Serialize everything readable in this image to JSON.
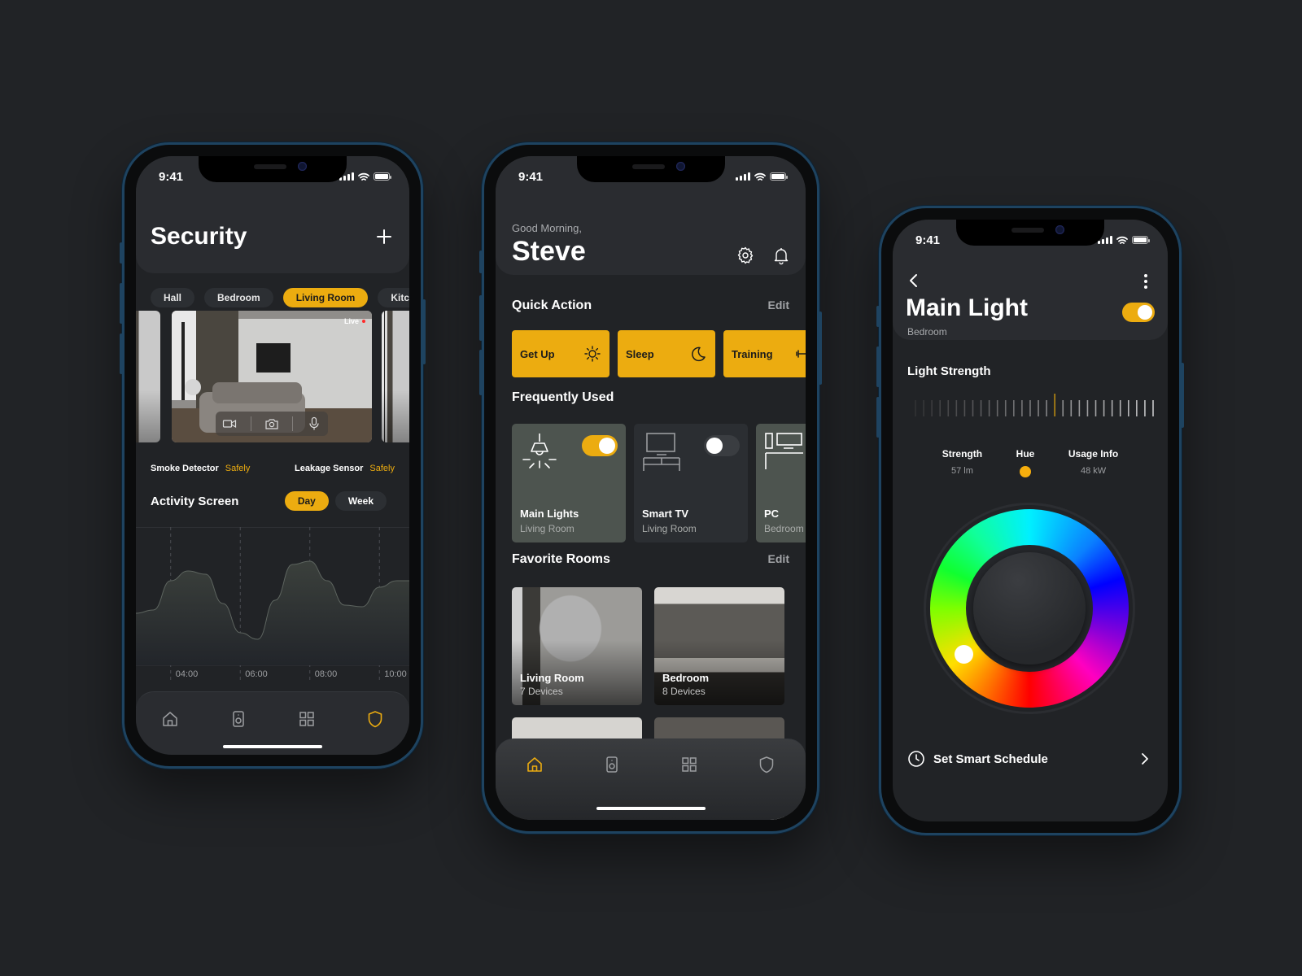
{
  "status_bar": {
    "time": "9:41"
  },
  "colors": {
    "accent": "#ECAC10",
    "background": "#212326",
    "card": "#2A2C30",
    "device_on_card": "#4D544F"
  },
  "security_screen": {
    "title": "Security",
    "add_icon": "plus-icon",
    "room_filters": [
      {
        "label": "Hall",
        "active": false
      },
      {
        "label": "Bedroom",
        "active": false
      },
      {
        "label": "Living Room",
        "active": true
      },
      {
        "label": "Kitch",
        "active": false
      }
    ],
    "camera": {
      "live_label": "Live",
      "controls": [
        "video-icon",
        "camera-icon",
        "microphone-icon"
      ]
    },
    "sensors": [
      {
        "name": "Smoke Detector",
        "status": "Safely"
      },
      {
        "name": "Leakage Sensor",
        "status": "Safely"
      }
    ],
    "activity": {
      "title": "Activity Screen",
      "ranges": [
        {
          "label": "Day",
          "active": true
        },
        {
          "label": "Week",
          "active": false
        }
      ]
    },
    "tab_bar": [
      {
        "icon": "home-icon",
        "active": false
      },
      {
        "icon": "speaker-icon",
        "active": false
      },
      {
        "icon": "grid-icon",
        "active": false
      },
      {
        "icon": "shield-icon",
        "active": true
      }
    ]
  },
  "chart_data": {
    "type": "area",
    "title": "Activity Screen",
    "x_ticks": [
      "04:00",
      "06:00",
      "08:00",
      "10:00"
    ],
    "x": [
      3.0,
      3.5,
      4.0,
      4.5,
      5.0,
      5.5,
      6.0,
      6.5,
      7.0,
      7.5,
      8.0,
      8.5,
      9.0,
      9.5,
      10.0,
      10.5,
      11.0
    ],
    "values": [
      42,
      44,
      62,
      68,
      66,
      48,
      30,
      26,
      50,
      72,
      74,
      62,
      47,
      46,
      58,
      62,
      62
    ],
    "ylim": [
      0,
      100
    ],
    "grid": "vertical dashed at x ticks",
    "xlabel": "",
    "ylabel": ""
  },
  "home_screen": {
    "greeting": "Good Morning,",
    "user_name": "Steve",
    "quick_action": {
      "title": "Quick Action",
      "edit_label": "Edit",
      "items": [
        {
          "label": "Get Up",
          "icon": "sun-icon"
        },
        {
          "label": "Sleep",
          "icon": "moon-icon"
        },
        {
          "label": "Training",
          "icon": "dumbbell-icon"
        }
      ]
    },
    "frequently_used": {
      "title": "Frequently Used",
      "devices": [
        {
          "name": "Main Lights",
          "room": "Living Room",
          "on": true,
          "icon": "ceiling-lamp-icon"
        },
        {
          "name": "Smart TV",
          "room": "Living Room",
          "on": false,
          "icon": "tv-icon"
        },
        {
          "name": "PC",
          "room": "Bedroom",
          "on": true,
          "icon": "desk-pc-icon"
        }
      ]
    },
    "favorite_rooms": {
      "title": "Favorite Rooms",
      "edit_label": "Edit",
      "rooms": [
        {
          "name": "Living Room",
          "devices": "7 Devices"
        },
        {
          "name": "Bedroom",
          "devices": "8 Devices"
        },
        {
          "name": "",
          "devices": ""
        },
        {
          "name": "",
          "devices": ""
        }
      ]
    },
    "tab_bar": [
      {
        "icon": "home-icon",
        "active": true
      },
      {
        "icon": "speaker-icon",
        "active": false
      },
      {
        "icon": "grid-icon",
        "active": false
      },
      {
        "icon": "shield-icon",
        "active": false
      }
    ]
  },
  "light_screen": {
    "title": "Main Light",
    "room": "Bedroom",
    "power_on": true,
    "light_strength": {
      "title": "Light Strength",
      "tick_count": 30,
      "level_fraction": 0.6
    },
    "stats": [
      {
        "label": "Strength",
        "value": "57 lm"
      },
      {
        "label": "Hue",
        "value_color": "#F6AE0D"
      },
      {
        "label": "Usage Info",
        "value": "48 kW"
      }
    ],
    "color_wheel": {
      "selected_hue_deg": 50
    },
    "schedule_label": "Set Smart Schedule"
  }
}
